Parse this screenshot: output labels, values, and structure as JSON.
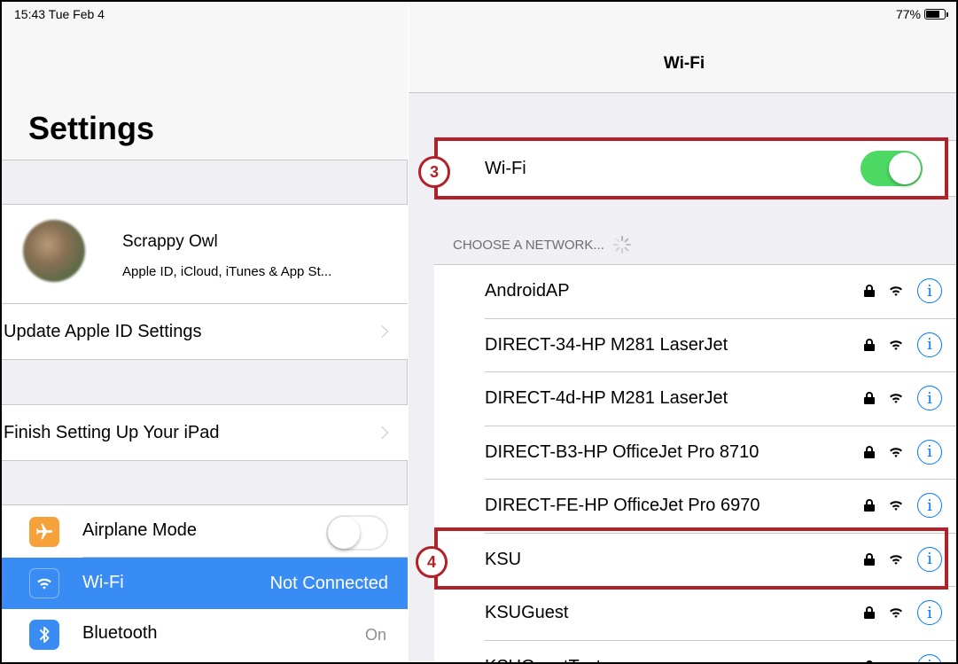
{
  "status_bar": {
    "time": "15:43  Tue Feb 4",
    "battery": "77%",
    "battery_level": 0.77
  },
  "left_pane": {
    "title": "Settings",
    "profile": {
      "name": "Scrappy Owl",
      "subtitle": "Apple ID, iCloud, iTunes & App St...",
      "update_label": "Update Apple ID Settings"
    },
    "setup_label": "Finish Setting Up Your iPad",
    "items": [
      {
        "label": "Airplane Mode",
        "icon": "airplane-icon",
        "icon_color": "#f7a13a",
        "toggle": false
      },
      {
        "label": "Wi-Fi",
        "value": "Not Connected",
        "icon": "wifi-icon",
        "icon_color": "#3a8cf5",
        "selected": true
      },
      {
        "label": "Bluetooth",
        "value": "On",
        "icon": "bluetooth-icon",
        "icon_color": "#3a8cf5"
      }
    ]
  },
  "right_pane": {
    "title": "Wi-Fi",
    "wifi_toggle_label": "Wi-Fi",
    "wifi_enabled": true,
    "section_header": "CHOOSE A NETWORK...",
    "networks": [
      {
        "name": "AndroidAP",
        "secured": true
      },
      {
        "name": "DIRECT-34-HP M281 LaserJet",
        "secured": true
      },
      {
        "name": "DIRECT-4d-HP M281 LaserJet",
        "secured": true
      },
      {
        "name": "DIRECT-B3-HP OfficeJet Pro 8710",
        "secured": true
      },
      {
        "name": "DIRECT-FE-HP OfficeJet Pro 6970",
        "secured": true
      },
      {
        "name": "KSU",
        "secured": true
      },
      {
        "name": "KSUGuest",
        "secured": true
      },
      {
        "name": "KSUGuestTest",
        "secured": true
      }
    ]
  },
  "annotations": {
    "step_3": "3",
    "step_4": "4",
    "color": "#b22127"
  },
  "colors": {
    "accent": "#007aff",
    "toggle_on": "#4cd964",
    "selected_row": "#3a8cf5"
  }
}
